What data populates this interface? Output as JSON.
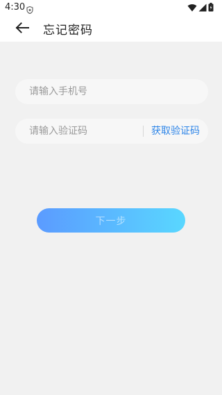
{
  "status_bar": {
    "time": "4:30",
    "icons": [
      "shield-icon",
      "wifi-icon",
      "signal-icon",
      "battery-icon"
    ]
  },
  "header": {
    "title": "忘记密码",
    "back_icon": "arrow-left-icon"
  },
  "form": {
    "phone_placeholder": "请输入手机号",
    "phone_value": "",
    "code_placeholder": "请输入验证码",
    "code_value": "",
    "get_code_label": "获取验证码"
  },
  "next_button": {
    "label": "下一步"
  },
  "colors": {
    "accent": "#2f86e8",
    "button_gradient_start": "#5b9bff",
    "button_gradient_end": "#59d7ff",
    "background": "#f1f1f1"
  }
}
